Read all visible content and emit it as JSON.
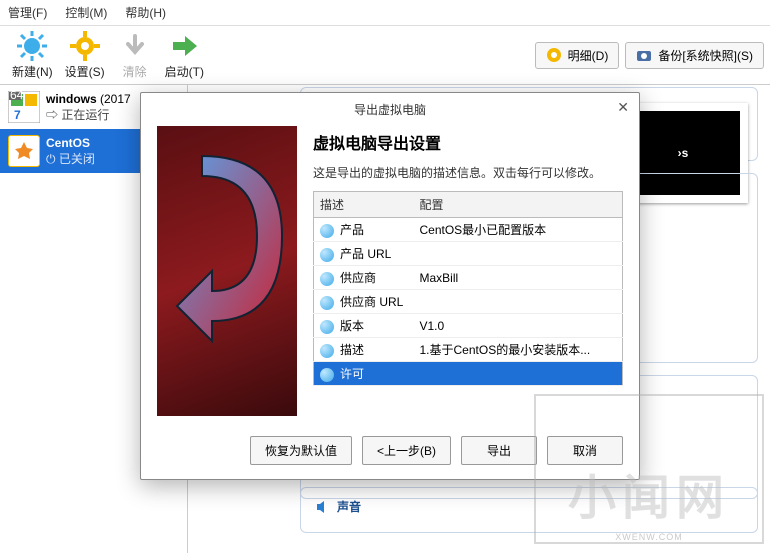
{
  "menu": {
    "manage": "管理(F)",
    "control": "控制(M)",
    "help": "帮助(H)"
  },
  "toolbar": {
    "new": "新建(N)",
    "settings": "设置(S)",
    "clear": "清除",
    "start": "启动(T)"
  },
  "right_buttons": {
    "detail": "明细(D)",
    "backup": "备份[系统快照](S)"
  },
  "vms": [
    {
      "name": "windows",
      "date": "(2017",
      "status": "正在运行"
    },
    {
      "name": "CentOS",
      "status": "已关闭"
    }
  ],
  "thumb_text": "›s",
  "panel_sound": "声音",
  "dialog": {
    "title": "导出虚拟电脑",
    "heading": "虚拟电脑导出设置",
    "desc": "这是导出的虚拟电脑的描述信息。双击每行可以修改。",
    "cols": {
      "c1": "描述",
      "c2": "配置"
    },
    "rows": [
      {
        "k": "产品",
        "v": "CentOS最小已配置版本"
      },
      {
        "k": "产品 URL",
        "v": ""
      },
      {
        "k": "供应商",
        "v": "MaxBill"
      },
      {
        "k": "供应商 URL",
        "v": ""
      },
      {
        "k": "版本",
        "v": "V1.0"
      },
      {
        "k": "描述",
        "v": "1.基于CentOS的最小安装版本..."
      },
      {
        "k": "许可",
        "v": ""
      }
    ],
    "buttons": {
      "reset": "恢复为默认值",
      "prev": "<上一步(B)",
      "export": "导出",
      "cancel": "取消"
    }
  },
  "watermark": {
    "big": "小闻网",
    "url": "XWENW.COM"
  }
}
